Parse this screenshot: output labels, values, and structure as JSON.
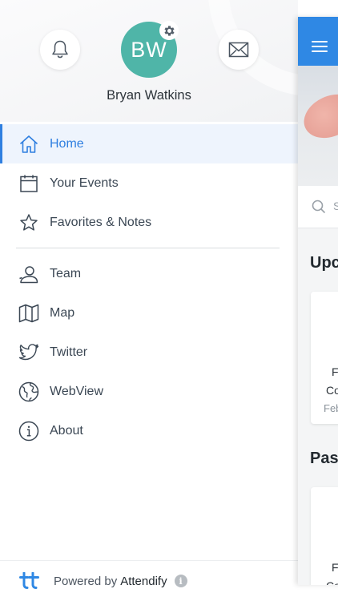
{
  "user": {
    "initials": "BW",
    "name": "Bryan Watkins"
  },
  "colors": {
    "accent": "#2f7fe0",
    "avatar": "#4fb5a8",
    "topbar": "#2f88e4"
  },
  "header_icons": {
    "left": "bell-icon",
    "right": "mail-icon",
    "badge": "gear-icon"
  },
  "nav": {
    "primary": [
      {
        "label": "Home",
        "icon": "home-icon",
        "active": true
      },
      {
        "label": "Your Events",
        "icon": "calendar-icon"
      },
      {
        "label": "Favorites & Notes",
        "icon": "star-icon"
      }
    ],
    "secondary": [
      {
        "label": "Team",
        "icon": "person-icon"
      },
      {
        "label": "Map",
        "icon": "map-icon"
      },
      {
        "label": "Twitter",
        "icon": "twitter-icon"
      },
      {
        "label": "WebView",
        "icon": "globe-icon"
      },
      {
        "label": "About",
        "icon": "info-icon"
      }
    ]
  },
  "footer": {
    "powered": "Powered by",
    "brand": "Attendify",
    "info_glyph": "i"
  },
  "main": {
    "search_placeholder": "S",
    "section_upcoming": "Upc",
    "card1": {
      "line1": "F",
      "line2": "Co",
      "line3": "Feb"
    },
    "section_past": "Pas",
    "card2": {
      "line1": "F",
      "line2": "Co"
    }
  }
}
